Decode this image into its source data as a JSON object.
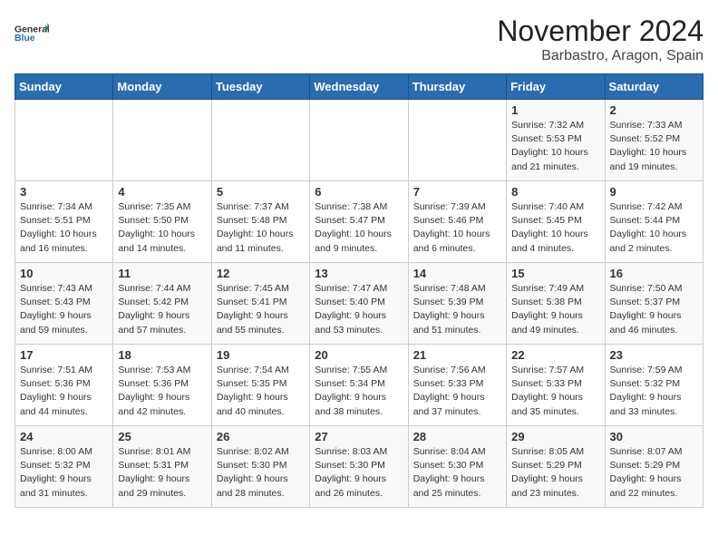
{
  "logo": {
    "line1": "General",
    "line2": "Blue"
  },
  "title": "November 2024",
  "location": "Barbastro, Aragon, Spain",
  "days_of_week": [
    "Sunday",
    "Monday",
    "Tuesday",
    "Wednesday",
    "Thursday",
    "Friday",
    "Saturday"
  ],
  "weeks": [
    [
      {
        "day": "",
        "info": ""
      },
      {
        "day": "",
        "info": ""
      },
      {
        "day": "",
        "info": ""
      },
      {
        "day": "",
        "info": ""
      },
      {
        "day": "",
        "info": ""
      },
      {
        "day": "1",
        "info": "Sunrise: 7:32 AM\nSunset: 5:53 PM\nDaylight: 10 hours and 21 minutes."
      },
      {
        "day": "2",
        "info": "Sunrise: 7:33 AM\nSunset: 5:52 PM\nDaylight: 10 hours and 19 minutes."
      }
    ],
    [
      {
        "day": "3",
        "info": "Sunrise: 7:34 AM\nSunset: 5:51 PM\nDaylight: 10 hours and 16 minutes."
      },
      {
        "day": "4",
        "info": "Sunrise: 7:35 AM\nSunset: 5:50 PM\nDaylight: 10 hours and 14 minutes."
      },
      {
        "day": "5",
        "info": "Sunrise: 7:37 AM\nSunset: 5:48 PM\nDaylight: 10 hours and 11 minutes."
      },
      {
        "day": "6",
        "info": "Sunrise: 7:38 AM\nSunset: 5:47 PM\nDaylight: 10 hours and 9 minutes."
      },
      {
        "day": "7",
        "info": "Sunrise: 7:39 AM\nSunset: 5:46 PM\nDaylight: 10 hours and 6 minutes."
      },
      {
        "day": "8",
        "info": "Sunrise: 7:40 AM\nSunset: 5:45 PM\nDaylight: 10 hours and 4 minutes."
      },
      {
        "day": "9",
        "info": "Sunrise: 7:42 AM\nSunset: 5:44 PM\nDaylight: 10 hours and 2 minutes."
      }
    ],
    [
      {
        "day": "10",
        "info": "Sunrise: 7:43 AM\nSunset: 5:43 PM\nDaylight: 9 hours and 59 minutes."
      },
      {
        "day": "11",
        "info": "Sunrise: 7:44 AM\nSunset: 5:42 PM\nDaylight: 9 hours and 57 minutes."
      },
      {
        "day": "12",
        "info": "Sunrise: 7:45 AM\nSunset: 5:41 PM\nDaylight: 9 hours and 55 minutes."
      },
      {
        "day": "13",
        "info": "Sunrise: 7:47 AM\nSunset: 5:40 PM\nDaylight: 9 hours and 53 minutes."
      },
      {
        "day": "14",
        "info": "Sunrise: 7:48 AM\nSunset: 5:39 PM\nDaylight: 9 hours and 51 minutes."
      },
      {
        "day": "15",
        "info": "Sunrise: 7:49 AM\nSunset: 5:38 PM\nDaylight: 9 hours and 49 minutes."
      },
      {
        "day": "16",
        "info": "Sunrise: 7:50 AM\nSunset: 5:37 PM\nDaylight: 9 hours and 46 minutes."
      }
    ],
    [
      {
        "day": "17",
        "info": "Sunrise: 7:51 AM\nSunset: 5:36 PM\nDaylight: 9 hours and 44 minutes."
      },
      {
        "day": "18",
        "info": "Sunrise: 7:53 AM\nSunset: 5:36 PM\nDaylight: 9 hours and 42 minutes."
      },
      {
        "day": "19",
        "info": "Sunrise: 7:54 AM\nSunset: 5:35 PM\nDaylight: 9 hours and 40 minutes."
      },
      {
        "day": "20",
        "info": "Sunrise: 7:55 AM\nSunset: 5:34 PM\nDaylight: 9 hours and 38 minutes."
      },
      {
        "day": "21",
        "info": "Sunrise: 7:56 AM\nSunset: 5:33 PM\nDaylight: 9 hours and 37 minutes."
      },
      {
        "day": "22",
        "info": "Sunrise: 7:57 AM\nSunset: 5:33 PM\nDaylight: 9 hours and 35 minutes."
      },
      {
        "day": "23",
        "info": "Sunrise: 7:59 AM\nSunset: 5:32 PM\nDaylight: 9 hours and 33 minutes."
      }
    ],
    [
      {
        "day": "24",
        "info": "Sunrise: 8:00 AM\nSunset: 5:32 PM\nDaylight: 9 hours and 31 minutes."
      },
      {
        "day": "25",
        "info": "Sunrise: 8:01 AM\nSunset: 5:31 PM\nDaylight: 9 hours and 29 minutes."
      },
      {
        "day": "26",
        "info": "Sunrise: 8:02 AM\nSunset: 5:30 PM\nDaylight: 9 hours and 28 minutes."
      },
      {
        "day": "27",
        "info": "Sunrise: 8:03 AM\nSunset: 5:30 PM\nDaylight: 9 hours and 26 minutes."
      },
      {
        "day": "28",
        "info": "Sunrise: 8:04 AM\nSunset: 5:30 PM\nDaylight: 9 hours and 25 minutes."
      },
      {
        "day": "29",
        "info": "Sunrise: 8:05 AM\nSunset: 5:29 PM\nDaylight: 9 hours and 23 minutes."
      },
      {
        "day": "30",
        "info": "Sunrise: 8:07 AM\nSunset: 5:29 PM\nDaylight: 9 hours and 22 minutes."
      }
    ]
  ]
}
